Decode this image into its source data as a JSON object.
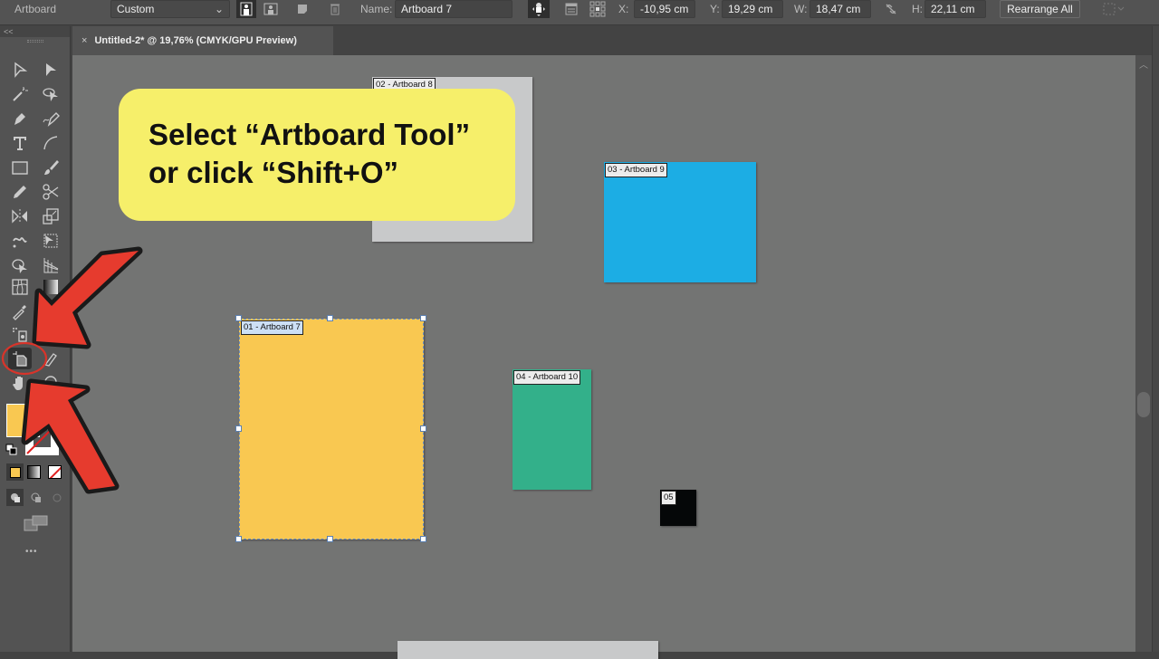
{
  "control_bar": {
    "tool_name": "Artboard",
    "preset": "Custom",
    "name_label": "Name:",
    "name_value": "Artboard 7",
    "x_label": "X:",
    "x_value": "-10,95 cm",
    "y_label": "Y:",
    "y_value": "19,29 cm",
    "w_label": "W:",
    "w_value": "18,47 cm",
    "h_label": "H:",
    "h_value": "22,11 cm",
    "rearrange_label": "Rearrange All"
  },
  "document_tab": {
    "close_glyph": "×",
    "title": "Untitled-2* @ 19,76% (CMYK/GPU Preview)"
  },
  "toolbar": {
    "collapse_glyph": "<<",
    "more_glyph": "•••",
    "fill_color": "#f9c851",
    "active_tool": "artboard-tool"
  },
  "artboards": [
    {
      "label": "01 - Artboard 7",
      "color": "#f9c851",
      "selected": true
    },
    {
      "label": "02 - Artboard 8",
      "color": "#c8c9ca",
      "selected": false
    },
    {
      "label": "03 - Artboard 9",
      "color": "#1cade4",
      "selected": false
    },
    {
      "label": "04 - Artboard 10",
      "color": "#33b08a",
      "selected": false
    },
    {
      "label": "05",
      "color": "#050708",
      "selected": false
    }
  ],
  "callout": {
    "line1": "Select “Artboard Tool”",
    "line2": "or click “Shift+O”",
    "color": "#f6ef6a"
  },
  "annotation_color": "#e63b2e"
}
